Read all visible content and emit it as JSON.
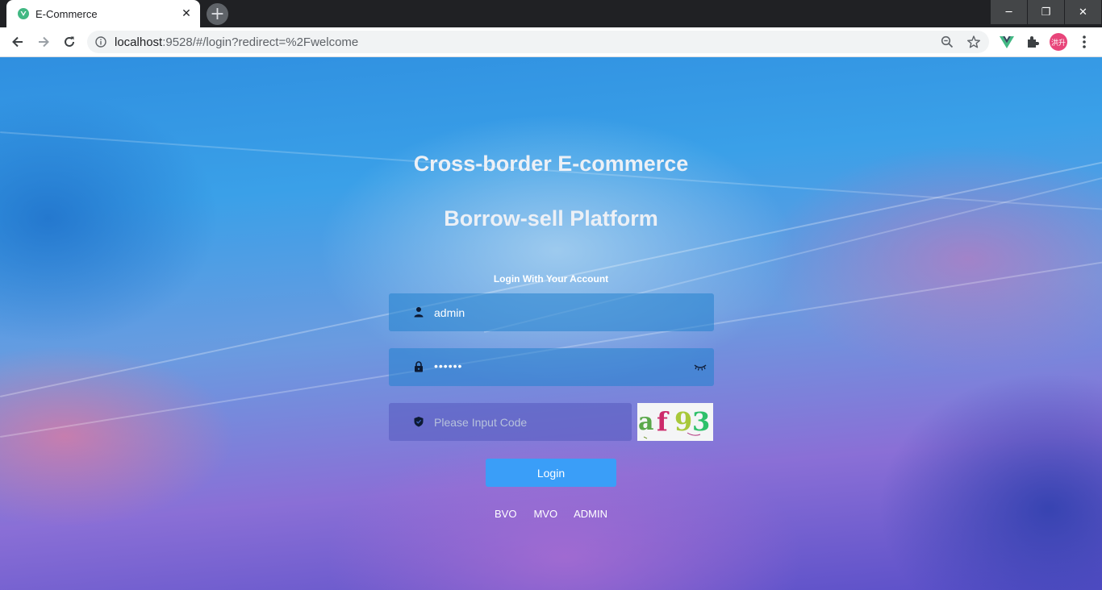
{
  "browser": {
    "tab_title": "E-Commerce",
    "tab_close": "✕",
    "new_tab": "+",
    "url_host": "localhost",
    "url_rest": ":9528/#/login?redirect=%2Fwelcome",
    "profile_label": "洪升",
    "window_controls": {
      "minimize": "─",
      "maximize": "❐",
      "close": "✕"
    },
    "icons": [
      "back-arrow-icon",
      "forward-arrow-icon",
      "reload-icon",
      "site-info-icon",
      "zoom-icon",
      "star-icon",
      "vue-devtools-icon",
      "extensions-icon",
      "menu-icon"
    ]
  },
  "page": {
    "title_line1": "Cross-border E-commerce",
    "title_line2": "Borrow-sell Platform",
    "subtitle": "Login With Your Account",
    "username": {
      "value": "admin",
      "icon": "user-icon"
    },
    "password": {
      "masked": "••••••",
      "icon": "lock-icon",
      "toggle_icon": "eye-closed-icon"
    },
    "code": {
      "placeholder": "Please Input Code",
      "icon": "shield-icon"
    },
    "captcha_chars": [
      {
        "ch": "a",
        "color": "#5aa84a"
      },
      {
        "ch": "f",
        "color": "#cc2a6a"
      },
      {
        "ch": "9",
        "color": "#a8c83a"
      },
      {
        "ch": "3",
        "color": "#2ec06a"
      }
    ],
    "login_button": "Login",
    "roles": [
      "BVO",
      "MVO",
      "ADMIN"
    ]
  },
  "colors": {
    "login_button": "#3a9ef8",
    "titlebar": "#202124"
  }
}
